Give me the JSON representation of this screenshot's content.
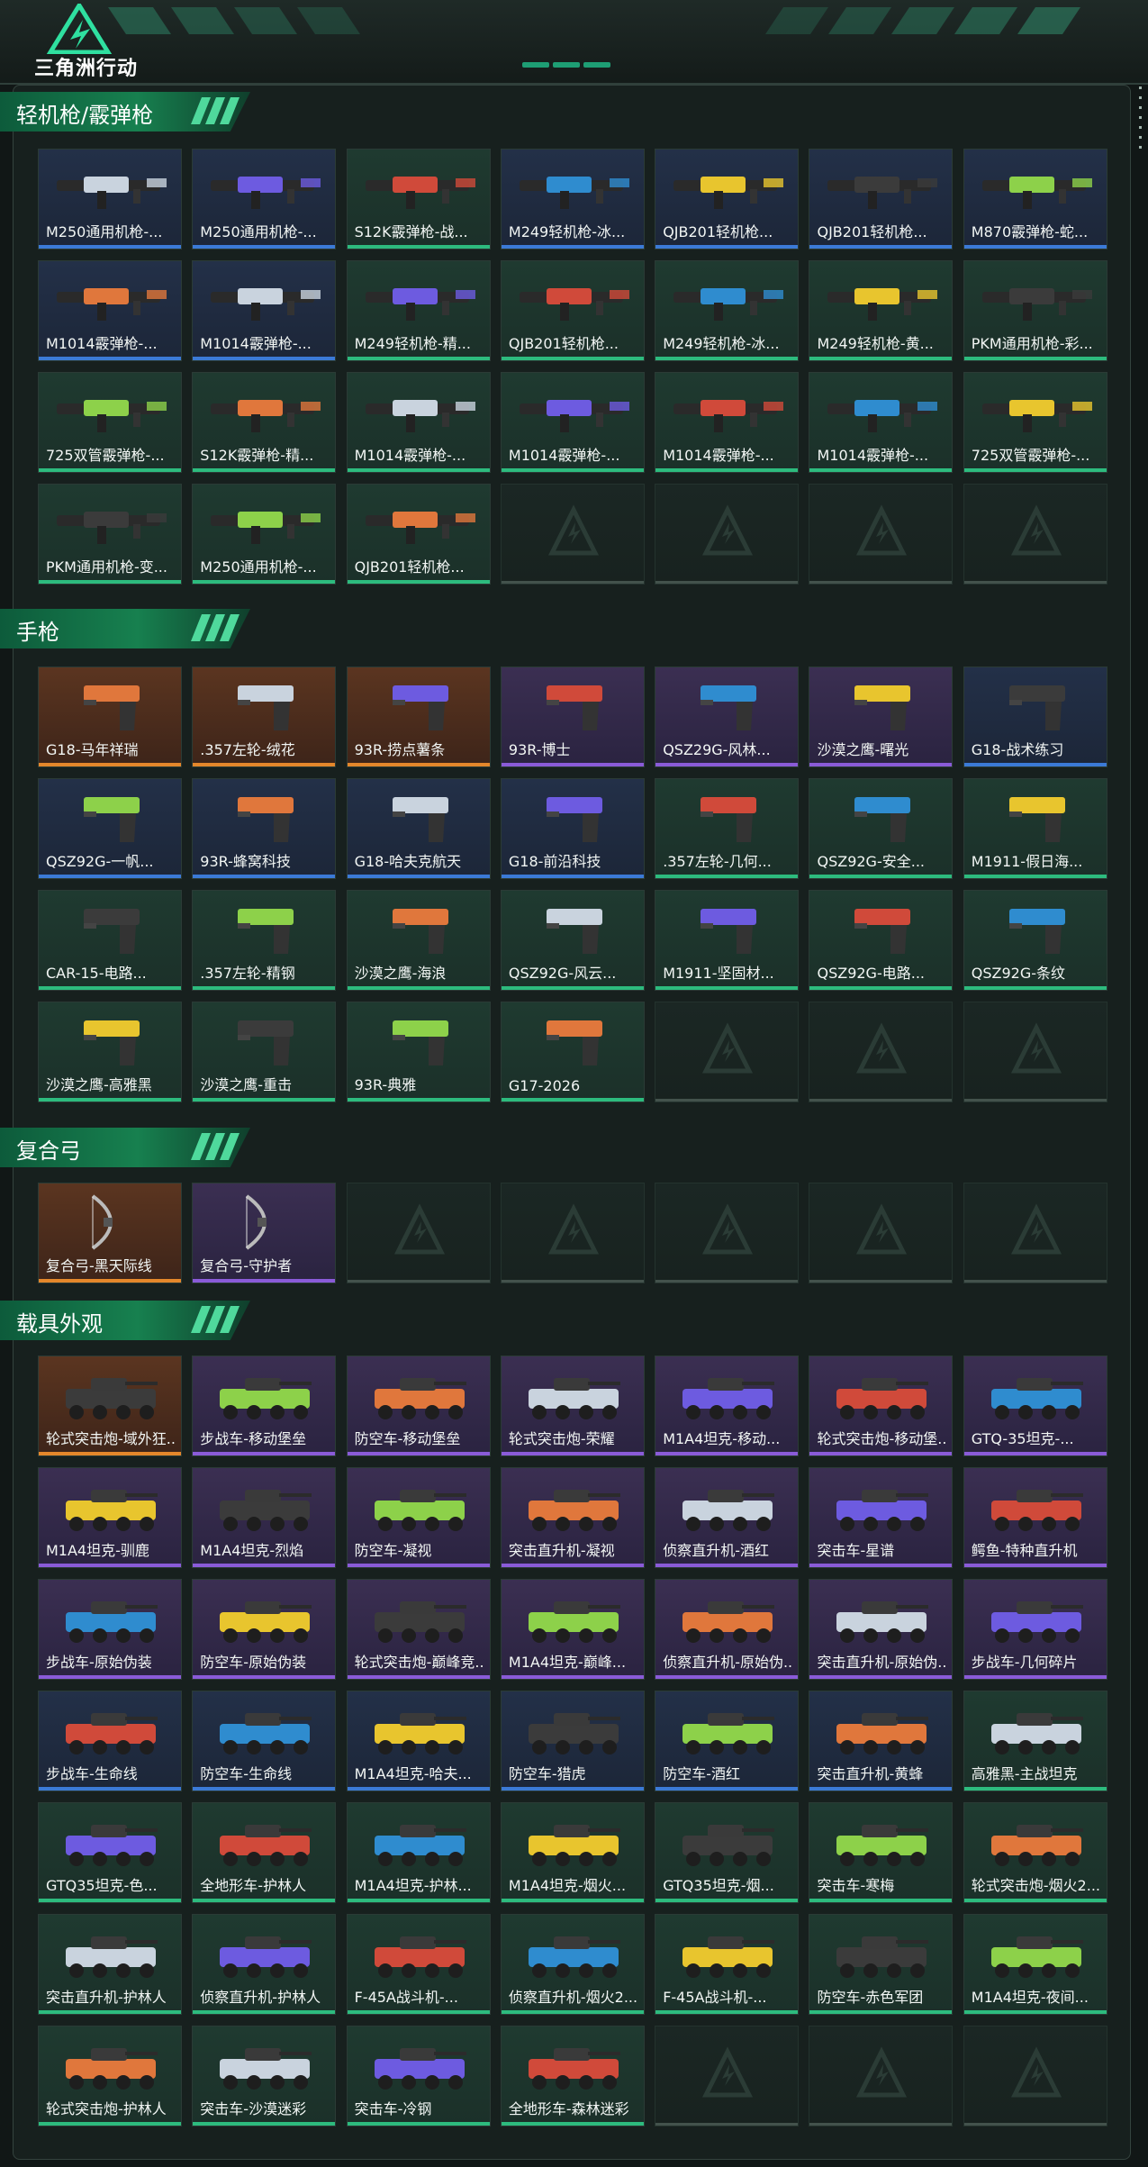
{
  "brand": {
    "title": "三角洲行动"
  },
  "sections": [
    {
      "title": "轻机枪/霰弹枪",
      "items": [
        {
          "name": "M250通用机枪-...",
          "rarity": "blue",
          "kind": "gun"
        },
        {
          "name": "M250通用机枪-...",
          "rarity": "blue",
          "kind": "gun"
        },
        {
          "name": "S12K霰弹枪-战...",
          "rarity": "green",
          "kind": "gun"
        },
        {
          "name": "M249轻机枪-冰...",
          "rarity": "blue",
          "kind": "gun"
        },
        {
          "name": "QJB201轻机枪...",
          "rarity": "blue",
          "kind": "gun"
        },
        {
          "name": "QJB201轻机枪...",
          "rarity": "blue",
          "kind": "gun"
        },
        {
          "name": "M870霰弹枪-蛇...",
          "rarity": "blue",
          "kind": "gun"
        },
        {
          "name": "M1014霰弹枪-...",
          "rarity": "blue",
          "kind": "gun"
        },
        {
          "name": "M1014霰弹枪-...",
          "rarity": "blue",
          "kind": "gun"
        },
        {
          "name": "M249轻机枪-精...",
          "rarity": "green",
          "kind": "gun"
        },
        {
          "name": "QJB201轻机枪...",
          "rarity": "green",
          "kind": "gun"
        },
        {
          "name": "M249轻机枪-冰...",
          "rarity": "green",
          "kind": "gun"
        },
        {
          "name": "M249轻机枪-黄...",
          "rarity": "green",
          "kind": "gun"
        },
        {
          "name": "PKM通用机枪-彩...",
          "rarity": "green",
          "kind": "gun"
        },
        {
          "name": "725双管霰弹枪-...",
          "rarity": "green",
          "kind": "gun"
        },
        {
          "name": "S12K霰弹枪-精...",
          "rarity": "green",
          "kind": "gun"
        },
        {
          "name": "M1014霰弹枪-...",
          "rarity": "green",
          "kind": "gun"
        },
        {
          "name": "M1014霰弹枪-...",
          "rarity": "green",
          "kind": "gun"
        },
        {
          "name": "M1014霰弹枪-...",
          "rarity": "green",
          "kind": "gun"
        },
        {
          "name": "M1014霰弹枪-...",
          "rarity": "green",
          "kind": "gun"
        },
        {
          "name": "725双管霰弹枪-...",
          "rarity": "green",
          "kind": "gun"
        },
        {
          "name": "PKM通用机枪-变...",
          "rarity": "green",
          "kind": "gun"
        },
        {
          "name": "M250通用机枪-...",
          "rarity": "green",
          "kind": "gun"
        },
        {
          "name": "QJB201轻机枪...",
          "rarity": "green",
          "kind": "gun"
        },
        {
          "name": "",
          "rarity": "empty",
          "kind": "empty"
        },
        {
          "name": "",
          "rarity": "empty",
          "kind": "empty"
        },
        {
          "name": "",
          "rarity": "empty",
          "kind": "empty"
        },
        {
          "name": "",
          "rarity": "empty",
          "kind": "empty"
        }
      ]
    },
    {
      "title": "手枪",
      "items": [
        {
          "name": "G18-马年祥瑞",
          "rarity": "gold",
          "kind": "pistol"
        },
        {
          "name": ".357左轮-绒花",
          "rarity": "gold",
          "kind": "pistol"
        },
        {
          "name": "93R-捞点薯条",
          "rarity": "gold",
          "kind": "pistol"
        },
        {
          "name": "93R-博士",
          "rarity": "purple",
          "kind": "pistol"
        },
        {
          "name": "QSZ29G-风林...",
          "rarity": "purple",
          "kind": "pistol"
        },
        {
          "name": "沙漠之鹰-曙光",
          "rarity": "purple",
          "kind": "pistol"
        },
        {
          "name": "G18-战术练习",
          "rarity": "blue",
          "kind": "pistol"
        },
        {
          "name": "QSZ92G-一帆...",
          "rarity": "blue",
          "kind": "pistol"
        },
        {
          "name": "93R-蜂窝科技",
          "rarity": "blue",
          "kind": "pistol"
        },
        {
          "name": "G18-哈夫克航天",
          "rarity": "blue",
          "kind": "pistol"
        },
        {
          "name": "G18-前沿科技",
          "rarity": "blue",
          "kind": "pistol"
        },
        {
          "name": ".357左轮-几何...",
          "rarity": "green",
          "kind": "pistol"
        },
        {
          "name": "QSZ92G-安全...",
          "rarity": "green",
          "kind": "pistol"
        },
        {
          "name": "M1911-假日海...",
          "rarity": "green",
          "kind": "pistol"
        },
        {
          "name": "CAR-15-电路...",
          "rarity": "green",
          "kind": "pistol"
        },
        {
          "name": ".357左轮-精钢",
          "rarity": "green",
          "kind": "pistol"
        },
        {
          "name": "沙漠之鹰-海浪",
          "rarity": "green",
          "kind": "pistol"
        },
        {
          "name": "QSZ92G-风云...",
          "rarity": "green",
          "kind": "pistol"
        },
        {
          "name": "M1911-坚固材...",
          "rarity": "green",
          "kind": "pistol"
        },
        {
          "name": "QSZ92G-电路...",
          "rarity": "green",
          "kind": "pistol"
        },
        {
          "name": "QSZ92G-条纹",
          "rarity": "green",
          "kind": "pistol"
        },
        {
          "name": "沙漠之鹰-高雅黑",
          "rarity": "green",
          "kind": "pistol"
        },
        {
          "name": "沙漠之鹰-重击",
          "rarity": "green",
          "kind": "pistol"
        },
        {
          "name": "93R-典雅",
          "rarity": "green",
          "kind": "pistol"
        },
        {
          "name": "G17-2026",
          "rarity": "green",
          "kind": "pistol"
        },
        {
          "name": "",
          "rarity": "empty",
          "kind": "empty"
        },
        {
          "name": "",
          "rarity": "empty",
          "kind": "empty"
        },
        {
          "name": "",
          "rarity": "empty",
          "kind": "empty"
        }
      ]
    },
    {
      "title": "复合弓",
      "items": [
        {
          "name": "复合弓-黑天际线",
          "rarity": "gold",
          "kind": "bow"
        },
        {
          "name": "复合弓-守护者",
          "rarity": "purple",
          "kind": "bow"
        },
        {
          "name": "",
          "rarity": "empty",
          "kind": "empty"
        },
        {
          "name": "",
          "rarity": "empty",
          "kind": "empty"
        },
        {
          "name": "",
          "rarity": "empty",
          "kind": "empty"
        },
        {
          "name": "",
          "rarity": "empty",
          "kind": "empty"
        },
        {
          "name": "",
          "rarity": "empty",
          "kind": "empty"
        }
      ]
    },
    {
      "title": "载具外观",
      "items": [
        {
          "name": "轮式突击炮-域外狂...",
          "rarity": "gold",
          "kind": "vehicle"
        },
        {
          "name": "步战车-移动堡垒",
          "rarity": "purple",
          "kind": "vehicle"
        },
        {
          "name": "防空车-移动堡垒",
          "rarity": "purple",
          "kind": "vehicle"
        },
        {
          "name": "轮式突击炮-荣耀",
          "rarity": "purple",
          "kind": "vehicle"
        },
        {
          "name": "M1A4坦克-移动...",
          "rarity": "purple",
          "kind": "vehicle"
        },
        {
          "name": "轮式突击炮-移动堡...",
          "rarity": "purple",
          "kind": "vehicle"
        },
        {
          "name": "GTQ-35坦克-...",
          "rarity": "purple",
          "kind": "vehicle"
        },
        {
          "name": "M1A4坦克-驯鹿",
          "rarity": "purple",
          "kind": "vehicle"
        },
        {
          "name": "M1A4坦克-烈焰",
          "rarity": "purple",
          "kind": "vehicle"
        },
        {
          "name": "防空车-凝视",
          "rarity": "purple",
          "kind": "vehicle"
        },
        {
          "name": "突击直升机-凝视",
          "rarity": "purple",
          "kind": "vehicle"
        },
        {
          "name": "侦察直升机-酒红",
          "rarity": "purple",
          "kind": "vehicle"
        },
        {
          "name": "突击车-星谱",
          "rarity": "purple",
          "kind": "vehicle"
        },
        {
          "name": "鳄鱼-特种直升机",
          "rarity": "purple",
          "kind": "vehicle"
        },
        {
          "name": "步战车-原始伪装",
          "rarity": "purple",
          "kind": "vehicle"
        },
        {
          "name": "防空车-原始伪装",
          "rarity": "purple",
          "kind": "vehicle"
        },
        {
          "name": "轮式突击炮-巅峰竞...",
          "rarity": "purple",
          "kind": "vehicle"
        },
        {
          "name": "M1A4坦克-巅峰...",
          "rarity": "purple",
          "kind": "vehicle"
        },
        {
          "name": "侦察直升机-原始伪...",
          "rarity": "purple",
          "kind": "vehicle"
        },
        {
          "name": "突击直升机-原始伪...",
          "rarity": "purple",
          "kind": "vehicle"
        },
        {
          "name": "步战车-几何碎片",
          "rarity": "purple",
          "kind": "vehicle"
        },
        {
          "name": "步战车-生命线",
          "rarity": "blue",
          "kind": "vehicle"
        },
        {
          "name": "防空车-生命线",
          "rarity": "blue",
          "kind": "vehicle"
        },
        {
          "name": "M1A4坦克-哈夫...",
          "rarity": "blue",
          "kind": "vehicle"
        },
        {
          "name": "防空车-猎虎",
          "rarity": "blue",
          "kind": "vehicle"
        },
        {
          "name": "防空车-酒红",
          "rarity": "blue",
          "kind": "vehicle"
        },
        {
          "name": "突击直升机-黄蜂",
          "rarity": "blue",
          "kind": "vehicle"
        },
        {
          "name": "高雅黑-主战坦克",
          "rarity": "green",
          "kind": "vehicle"
        },
        {
          "name": "GTQ35坦克-色...",
          "rarity": "green",
          "kind": "vehicle"
        },
        {
          "name": "全地形车-护林人",
          "rarity": "green",
          "kind": "vehicle"
        },
        {
          "name": "M1A4坦克-护林...",
          "rarity": "green",
          "kind": "vehicle"
        },
        {
          "name": "M1A4坦克-烟火...",
          "rarity": "green",
          "kind": "vehicle"
        },
        {
          "name": "GTQ35坦克-烟...",
          "rarity": "green",
          "kind": "vehicle"
        },
        {
          "name": "突击车-寒梅",
          "rarity": "green",
          "kind": "vehicle"
        },
        {
          "name": "轮式突击炮-烟火2...",
          "rarity": "green",
          "kind": "vehicle"
        },
        {
          "name": "突击直升机-护林人",
          "rarity": "green",
          "kind": "vehicle"
        },
        {
          "name": "侦察直升机-护林人",
          "rarity": "green",
          "kind": "vehicle"
        },
        {
          "name": "F-45A战斗机-...",
          "rarity": "green",
          "kind": "vehicle"
        },
        {
          "name": "侦察直升机-烟火2...",
          "rarity": "green",
          "kind": "vehicle"
        },
        {
          "name": "F-45A战斗机-...",
          "rarity": "green",
          "kind": "vehicle"
        },
        {
          "name": "防空车-赤色军团",
          "rarity": "green",
          "kind": "vehicle"
        },
        {
          "name": "M1A4坦克-夜间...",
          "rarity": "green",
          "kind": "vehicle"
        },
        {
          "name": "轮式突击炮-护林人",
          "rarity": "green",
          "kind": "vehicle"
        },
        {
          "name": "突击车-沙漠迷彩",
          "rarity": "green",
          "kind": "vehicle"
        },
        {
          "name": "突击车-冷钢",
          "rarity": "green",
          "kind": "vehicle"
        },
        {
          "name": "全地形车-森林迷彩",
          "rarity": "green",
          "kind": "vehicle"
        },
        {
          "name": "",
          "rarity": "empty",
          "kind": "empty"
        },
        {
          "name": "",
          "rarity": "empty",
          "kind": "empty"
        },
        {
          "name": "",
          "rarity": "empty",
          "kind": "empty"
        }
      ]
    }
  ],
  "colors": {
    "accent": "#1e9e74",
    "gold": "#e4872b",
    "purple": "#8a5bd8",
    "blue": "#3b7ad6",
    "green": "#2dbb7e"
  }
}
